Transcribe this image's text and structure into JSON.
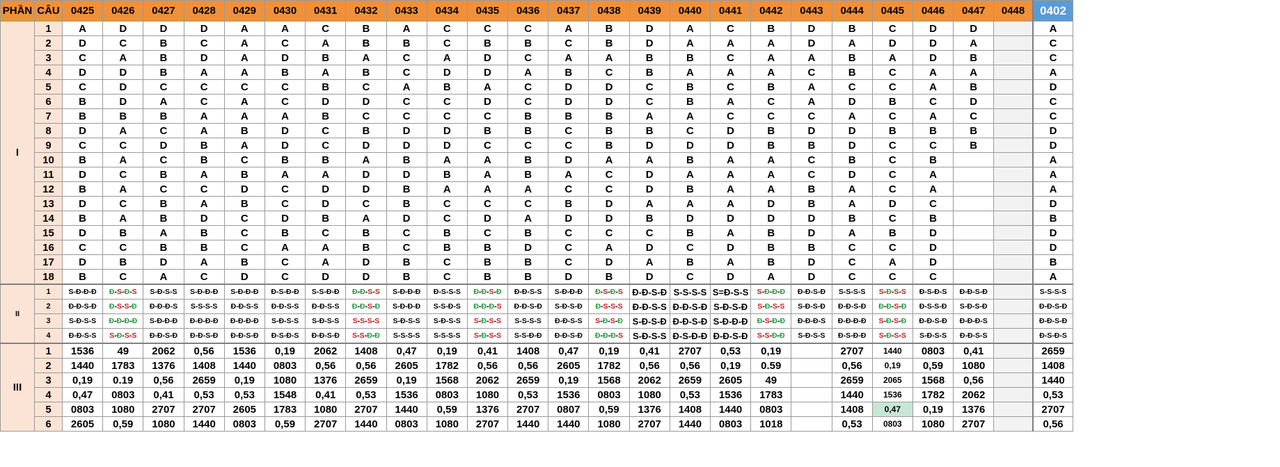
{
  "header": {
    "phan_label": "PHẦN",
    "cau_label": "CÂU",
    "codes": [
      "0425",
      "0426",
      "0427",
      "0428",
      "0429",
      "0430",
      "0431",
      "0432",
      "0433",
      "0434",
      "0435",
      "0436",
      "0437",
      "0438",
      "0439",
      "0440",
      "0441",
      "0442",
      "0443",
      "0444",
      "0445",
      "0446",
      "0447",
      "0448",
      "0402"
    ],
    "selected_code": "0402"
  },
  "sections": [
    {
      "label": "I",
      "rows": [
        {
          "q": "1",
          "cells": [
            "A",
            "D",
            "D",
            "D",
            "A",
            "A",
            "C",
            "B",
            "A",
            "C",
            "C",
            "C",
            "A",
            "B",
            "D",
            "A",
            "C",
            "B",
            "D",
            "B",
            "C",
            "D",
            "D",
            "",
            "A"
          ]
        },
        {
          "q": "2",
          "cells": [
            "D",
            "C",
            "B",
            "C",
            "A",
            "C",
            "A",
            "B",
            "B",
            "C",
            "B",
            "B",
            "C",
            "B",
            "D",
            "A",
            "A",
            "A",
            "D",
            "A",
            "D",
            "D",
            "A",
            "",
            "C"
          ]
        },
        {
          "q": "3",
          "cells": [
            "C",
            "A",
            "B",
            "D",
            "A",
            "D",
            "B",
            "A",
            "C",
            "A",
            "D",
            "C",
            "A",
            "A",
            "B",
            "B",
            "C",
            "A",
            "A",
            "B",
            "A",
            "D",
            "B",
            "",
            "C"
          ]
        },
        {
          "q": "4",
          "cells": [
            "D",
            "D",
            "B",
            "A",
            "A",
            "B",
            "A",
            "B",
            "C",
            "D",
            "D",
            "A",
            "B",
            "C",
            "B",
            "A",
            "A",
            "A",
            "C",
            "B",
            "C",
            "A",
            "A",
            "",
            "A"
          ]
        },
        {
          "q": "5",
          "cells": [
            "C",
            "D",
            "C",
            "C",
            "C",
            "C",
            "B",
            "C",
            "A",
            "B",
            "A",
            "C",
            "D",
            "D",
            "C",
            "B",
            "C",
            "B",
            "A",
            "C",
            "C",
            "A",
            "B",
            "",
            "D"
          ]
        },
        {
          "q": "6",
          "cells": [
            "B",
            "D",
            "A",
            "C",
            "A",
            "C",
            "D",
            "D",
            "C",
            "C",
            "D",
            "C",
            "D",
            "D",
            "C",
            "B",
            "A",
            "C",
            "A",
            "D",
            "B",
            "C",
            "D",
            "",
            "C"
          ]
        },
        {
          "q": "7",
          "cells": [
            "B",
            "B",
            "B",
            "A",
            "A",
            "A",
            "B",
            "C",
            "C",
            "C",
            "C",
            "B",
            "B",
            "B",
            "A",
            "A",
            "C",
            "C",
            "C",
            "A",
            "C",
            "A",
            "C",
            "",
            "C"
          ]
        },
        {
          "q": "8",
          "cells": [
            "D",
            "A",
            "C",
            "A",
            "B",
            "D",
            "C",
            "B",
            "D",
            "D",
            "B",
            "B",
            "C",
            "B",
            "B",
            "C",
            "D",
            "B",
            "D",
            "D",
            "B",
            "B",
            "B",
            "",
            "D"
          ]
        },
        {
          "q": "9",
          "cells": [
            "C",
            "C",
            "D",
            "B",
            "A",
            "D",
            "C",
            "D",
            "D",
            "D",
            "C",
            "C",
            "C",
            "B",
            "D",
            "D",
            "D",
            "B",
            "B",
            "D",
            "C",
            "C",
            "B",
            "",
            "D"
          ]
        },
        {
          "q": "10",
          "cells": [
            "B",
            "A",
            "C",
            "B",
            "C",
            "B",
            "B",
            "A",
            "B",
            "A",
            "A",
            "B",
            "D",
            "A",
            "A",
            "B",
            "A",
            "A",
            "C",
            "B",
            "C",
            "B",
            "",
            "",
            "A"
          ]
        },
        {
          "q": "11",
          "cells": [
            "D",
            "C",
            "B",
            "A",
            "B",
            "A",
            "A",
            "D",
            "D",
            "B",
            "A",
            "B",
            "A",
            "C",
            "D",
            "A",
            "A",
            "A",
            "C",
            "D",
            "C",
            "A",
            "",
            "",
            "A"
          ]
        },
        {
          "q": "12",
          "cells": [
            "B",
            "A",
            "C",
            "C",
            "D",
            "C",
            "D",
            "D",
            "B",
            "A",
            "A",
            "A",
            "C",
            "C",
            "D",
            "B",
            "A",
            "A",
            "B",
            "A",
            "C",
            "A",
            "",
            "",
            "A"
          ]
        },
        {
          "q": "13",
          "cells": [
            "D",
            "C",
            "B",
            "A",
            "B",
            "C",
            "D",
            "C",
            "B",
            "C",
            "C",
            "C",
            "B",
            "D",
            "A",
            "A",
            "A",
            "D",
            "B",
            "A",
            "D",
            "C",
            "",
            "",
            "D"
          ]
        },
        {
          "q": "14",
          "cells": [
            "B",
            "A",
            "B",
            "D",
            "C",
            "D",
            "B",
            "A",
            "D",
            "C",
            "D",
            "A",
            "D",
            "D",
            "B",
            "D",
            "D",
            "D",
            "D",
            "B",
            "C",
            "B",
            "",
            "",
            "B"
          ]
        },
        {
          "q": "15",
          "cells": [
            "D",
            "B",
            "A",
            "B",
            "C",
            "B",
            "C",
            "B",
            "C",
            "B",
            "C",
            "B",
            "C",
            "C",
            "C",
            "B",
            "A",
            "B",
            "D",
            "A",
            "B",
            "D",
            "",
            "",
            "D"
          ]
        },
        {
          "q": "16",
          "cells": [
            "C",
            "C",
            "B",
            "B",
            "C",
            "A",
            "A",
            "B",
            "C",
            "B",
            "B",
            "D",
            "C",
            "A",
            "D",
            "C",
            "D",
            "B",
            "B",
            "C",
            "C",
            "D",
            "",
            "",
            "D"
          ]
        },
        {
          "q": "17",
          "cells": [
            "D",
            "B",
            "D",
            "A",
            "B",
            "C",
            "A",
            "D",
            "B",
            "C",
            "B",
            "B",
            "C",
            "D",
            "A",
            "B",
            "A",
            "B",
            "D",
            "C",
            "A",
            "D",
            "",
            "",
            "B"
          ]
        },
        {
          "q": "18",
          "cells": [
            "B",
            "C",
            "A",
            "C",
            "D",
            "C",
            "D",
            "D",
            "B",
            "C",
            "B",
            "B",
            "D",
            "B",
            "D",
            "C",
            "D",
            "A",
            "D",
            "C",
            "C",
            "C",
            "",
            "",
            "A"
          ]
        }
      ]
    },
    {
      "label": "II",
      "rows": [
        {
          "q": "1",
          "cells": [
            "S-Đ-Đ-Đ",
            "Đ-S-Đ-S",
            "S-Đ-S-S",
            "S-Đ-Đ-Đ",
            "S-Đ-Đ-Đ",
            "Đ-S-Đ-Đ",
            "S-S-Đ-Đ",
            "Đ-Đ-S-S",
            "S-Đ-Đ-Đ",
            "Đ-S-S-S",
            "Đ-Đ-S-Đ",
            "Đ-Đ-S-S",
            "S-Đ-Đ-Đ",
            "Đ-S-Đ-S",
            "Đ-Đ-S-Đ",
            "S-S-S-S",
            "S=Đ-S-S",
            "S-Đ-Đ-Đ",
            "Đ-Đ-S-Đ",
            "S-S-S-S",
            "S-Đ-S-S",
            "Đ-S-Đ-S",
            "Đ-Đ-S-Đ",
            "",
            "S-S-S-S"
          ]
        },
        {
          "q": "2",
          "cells": [
            "Đ-Đ-S-Đ",
            "Đ-S-S-Đ",
            "Đ-Đ-Đ-S",
            "S-S-S-S",
            "Đ-Đ-S-S",
            "Đ-Đ-S-S",
            "Đ-Đ-S-S",
            "Đ-Đ-S-Đ",
            "S-Đ-Đ-Đ",
            "S-S-Đ-S",
            "Đ-Đ-Đ-S",
            "Đ-Đ-S-Đ",
            "S-Đ-S-Đ",
            "Đ-S-S-S",
            "Đ-Đ-S-S",
            "Đ-Đ-S-Đ",
            "S-Đ-S-Đ",
            "S-Đ-S-S",
            "S-Đ-S-Đ",
            "Đ-Đ-S-Đ",
            "Đ-Đ-S-Đ",
            "Đ-S-S-Đ",
            "S-Đ-S-Đ",
            "",
            "Đ-Đ-S-Đ"
          ]
        },
        {
          "q": "3",
          "cells": [
            "S-Đ-S-S",
            "Đ-Đ-Đ-Đ",
            "S-Đ-Đ-Đ",
            "Đ-Đ-Đ-Đ",
            "Đ-Đ-Đ-Đ",
            "S-Đ-S-S",
            "S-Đ-S-S",
            "S-S-S-S",
            "S-Đ-S-S",
            "S-Đ-S-S",
            "S-Đ-S-S",
            "S-S-S-S",
            "Đ-Đ-S-S",
            "S-Đ-S-Đ",
            "S-Đ-S-Đ",
            "Đ-Đ-S-Đ",
            "S-Đ-Đ-Đ",
            "Đ-S-Đ-Đ",
            "Đ-Đ-Đ-S",
            "Đ-Đ-Đ-Đ",
            "S-Đ-S-Đ",
            "Đ-Đ-S-Đ",
            "Đ-Đ-Đ-S",
            "",
            "Đ-Đ-S-Đ"
          ]
        },
        {
          "q": "4",
          "cells": [
            "Đ-Đ-S-S",
            "S-Đ-S-S",
            "Đ-Đ-S-Đ",
            "Đ-Đ-S-Đ",
            "Đ-Đ-S-Đ",
            "Đ-S-Đ-S",
            "Đ-Đ-S-Đ",
            "S-S-Đ-Đ",
            "S-S-S-S",
            "S-S-S-S",
            "S-Đ-S-S",
            "S-S-Đ-Đ",
            "Đ-Đ-S-Đ",
            "Đ-Đ-Đ-S",
            "S-Đ-S-S",
            "Đ-S-Đ-Đ",
            "Đ-Đ-S-Đ",
            "S-S-Đ-Đ",
            "S-Đ-S-S",
            "Đ-S-Đ-Đ",
            "S-Đ-S-S",
            "S-Đ-S-S",
            "Đ-Đ-S-S",
            "",
            "Đ-S-Đ-S"
          ]
        }
      ]
    },
    {
      "label": "III",
      "rows": [
        {
          "q": "1",
          "cells": [
            "1536",
            "49",
            "2062",
            "0,56",
            "1536",
            "0,19",
            "2062",
            "1408",
            "0,47",
            "0,19",
            "0,41",
            "1408",
            "0,47",
            "0,19",
            "0,41",
            "2707",
            "0,53",
            "0,19",
            "",
            "2707",
            "1440",
            "0803",
            "0,41",
            "",
            "2659"
          ]
        },
        {
          "q": "2",
          "cells": [
            "1440",
            "1783",
            "1376",
            "1408",
            "1440",
            "0803",
            "0,56",
            "0,56",
            "2605",
            "1782",
            "0,56",
            "0,56",
            "2605",
            "1782",
            "0,56",
            "0,56",
            "0,19",
            "0.59",
            "",
            "0,56",
            "0,19",
            "0,59",
            "1080",
            "",
            "1408"
          ]
        },
        {
          "q": "3",
          "cells": [
            "0,19",
            "0.19",
            "0,56",
            "2659",
            "0,19",
            "1080",
            "1376",
            "2659",
            "0,19",
            "1568",
            "2062",
            "2659",
            "0,19",
            "1568",
            "2062",
            "2659",
            "2605",
            "49",
            "",
            "2659",
            "2065",
            "1568",
            "0,56",
            "",
            "1440"
          ]
        },
        {
          "q": "4",
          "cells": [
            "0,47",
            "0803",
            "0,41",
            "0,53",
            "0,53",
            "1548",
            "0,41",
            "0,53",
            "1536",
            "0803",
            "1080",
            "0,53",
            "1536",
            "0803",
            "1080",
            "0,53",
            "1536",
            "1783",
            "",
            "1440",
            "1536",
            "1782",
            "2062",
            "",
            "0,53"
          ]
        },
        {
          "q": "5",
          "cells": [
            "0803",
            "1080",
            "2707",
            "2707",
            "2605",
            "1783",
            "1080",
            "2707",
            "1440",
            "0,59",
            "1376",
            "2707",
            "0807",
            "0,59",
            "1376",
            "1408",
            "1440",
            "0803",
            "",
            "1408",
            "0,47",
            "0,19",
            "1376",
            "",
            "2707"
          ]
        },
        {
          "q": "6",
          "cells": [
            "2605",
            "0,59",
            "1080",
            "1440",
            "0803",
            "0,59",
            "2707",
            "1440",
            "0803",
            "1080",
            "2707",
            "1440",
            "1440",
            "1080",
            "2707",
            "1440",
            "0803",
            "1018",
            "",
            "0,53",
            "0803",
            "1080",
            "2707",
            "",
            "0,56"
          ]
        }
      ]
    }
  ],
  "colors": {
    "header_bg": "#f0903a",
    "selected_header_bg": "#5b9bd5",
    "left_column_bg": "#fbe4d5",
    "highlight_green_text": "#1e9a3a",
    "highlight_red_text": "#d01818",
    "highlight_cell_bg": "#c6e7d3"
  },
  "highlights": {
    "colored_tf_codes": [
      "0426",
      "0432",
      "0435",
      "0438",
      "0442",
      "0445"
    ],
    "green_cell": {
      "section": "III",
      "row": "5",
      "code": "0445"
    }
  }
}
